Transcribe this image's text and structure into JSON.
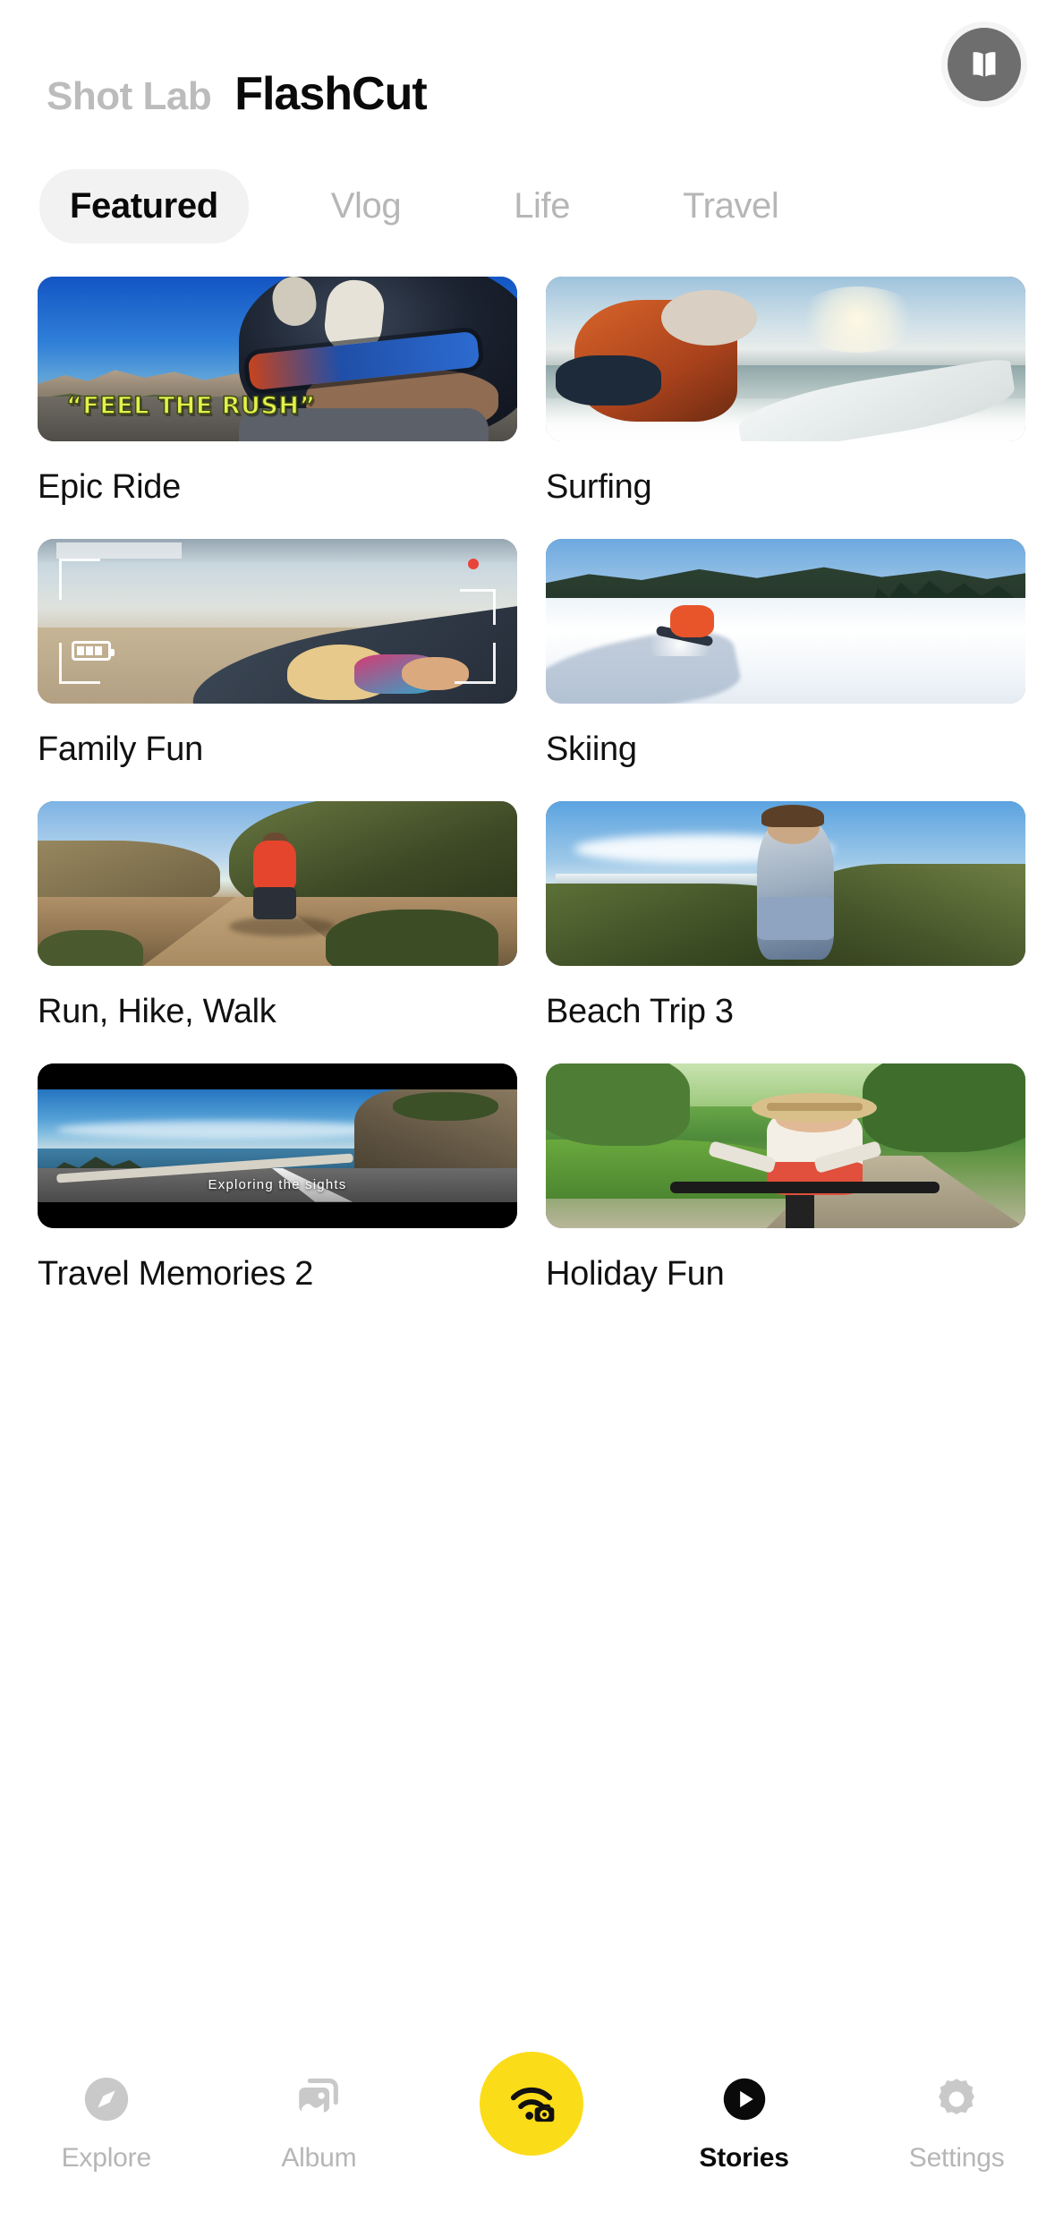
{
  "header": {
    "brand_sub": "Shot Lab",
    "brand_main": "FlashCut",
    "tutorial_icon": "book-icon"
  },
  "tabs": {
    "items": [
      {
        "label": "Featured",
        "active": true
      },
      {
        "label": "Vlog",
        "active": false
      },
      {
        "label": "Life",
        "active": false
      },
      {
        "label": "Travel",
        "active": false
      }
    ]
  },
  "grid": {
    "cards": [
      {
        "title": "Epic Ride",
        "overlay": "“FEEL THE RUSH”"
      },
      {
        "title": "Surfing",
        "overlay": ""
      },
      {
        "title": "Family Fun",
        "overlay": ""
      },
      {
        "title": "Skiing",
        "overlay": ""
      },
      {
        "title": "Run, Hike, Walk",
        "overlay": ""
      },
      {
        "title": "Beach Trip 3",
        "overlay": ""
      },
      {
        "title": "Travel Memories 2",
        "overlay": "Exploring the sights"
      },
      {
        "title": "Holiday Fun",
        "overlay": ""
      }
    ]
  },
  "bottom_nav": {
    "items": [
      {
        "label": "Explore",
        "icon": "compass-icon",
        "active": false
      },
      {
        "label": "Album",
        "icon": "photos-icon",
        "active": false
      },
      {
        "label": "Stories",
        "icon": "play-circle-icon",
        "active": true
      },
      {
        "label": "Settings",
        "icon": "gear-icon",
        "active": false
      }
    ],
    "fab_icon": "wifi-camera-icon"
  },
  "colors": {
    "accent_yellow": "#fbdc18",
    "active_text": "#0a0a0a",
    "inactive_text": "#b6b6b6",
    "tab_pill_bg": "#f2f2f2",
    "overlay_yellow": "#e3f24d"
  }
}
